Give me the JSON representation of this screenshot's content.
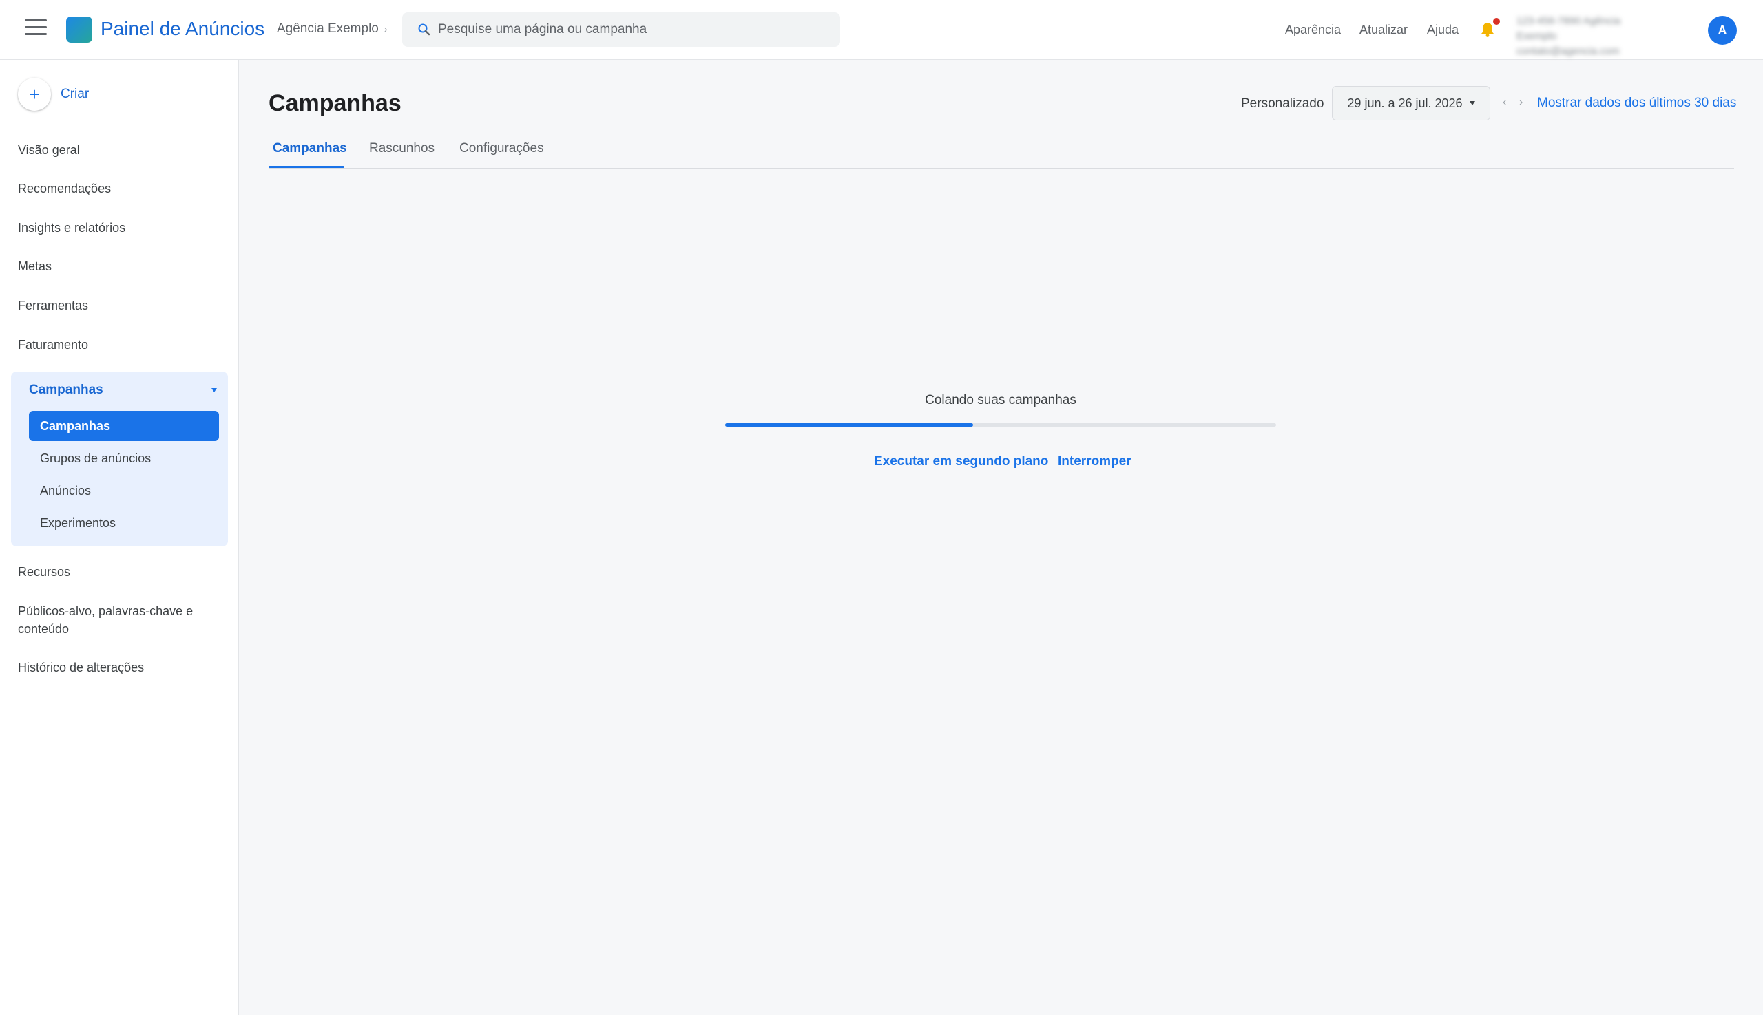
{
  "app": {
    "title": "Painel de Anúncios",
    "account": "Agência Exemplo",
    "brand_color": "#1a73e8"
  },
  "search": {
    "placeholder": "Pesquise uma página ou campanha",
    "value": ""
  },
  "header": {
    "links": [
      "Aparência",
      "Atualizar",
      "Ajuda"
    ],
    "notification_badge": true,
    "account_info_lines": [
      "123-456-7890 Agência",
      "Exemplo",
      "contato@agencia.com"
    ],
    "avatar_letter": "A"
  },
  "sidebar": {
    "create_label": "Criar",
    "items_top": [
      "Visão geral",
      "Recomendações",
      "Insights e relatórios",
      "Metas",
      "Ferramentas",
      "Faturamento"
    ],
    "group": {
      "title": "Campanhas",
      "expanded": true,
      "items": [
        "Campanhas",
        "Grupos de anúncios",
        "Anúncios",
        "Experimentos"
      ],
      "active_index": 0
    },
    "items_bottom": [
      "Recursos",
      "Públicos-alvo, palavras-chave e conteúdo",
      "Histórico de alterações"
    ]
  },
  "main": {
    "title": "Campanhas",
    "date_label": "Personalizado",
    "date_range": "29 jun. a 26 jul. 2026",
    "prev_arrow": "‹",
    "next_arrow": "›",
    "show_last30": "Mostrar dados dos últimos 30 dias",
    "tabs": [
      "Campanhas",
      "Rascunhos",
      "Configurações"
    ],
    "active_tab": 0
  },
  "loading": {
    "text": "Colando suas campanhas",
    "progress_fraction": 0.45,
    "run_background": "Executar em segundo plano",
    "stop": "Interromper"
  }
}
